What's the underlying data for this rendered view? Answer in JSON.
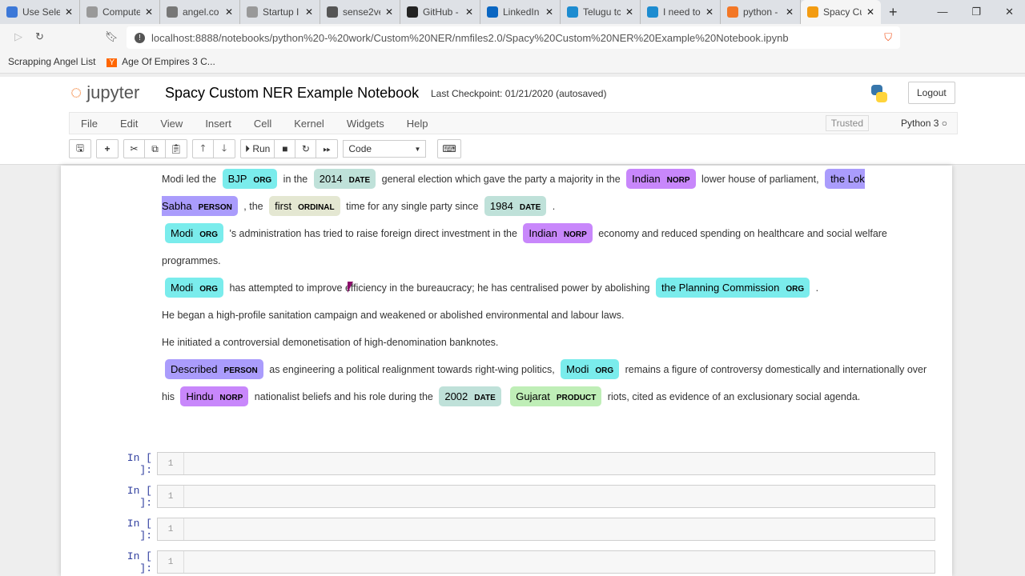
{
  "browser": {
    "tabs": [
      {
        "title": "Use Sele",
        "color": "#3c78d8"
      },
      {
        "title": "Compute",
        "color": "#999"
      },
      {
        "title": "angel.co",
        "color": "#777"
      },
      {
        "title": "Startup I",
        "color": "#999"
      },
      {
        "title": "sense2ve",
        "color": "#555"
      },
      {
        "title": "GitHub -",
        "color": "#222"
      },
      {
        "title": "LinkedIn",
        "color": "#0a66c2"
      },
      {
        "title": "Telugu tc",
        "color": "#1d8cd0"
      },
      {
        "title": "I need to",
        "color": "#1d8cd0"
      },
      {
        "title": "python -",
        "color": "#f37726"
      },
      {
        "title": "Spacy Cu",
        "color": "#f39c12"
      }
    ],
    "url": "localhost:8888/notebooks/python%20-%20work/Custom%20NER/nmfiles2.0/Spacy%20Custom%20NER%20Example%20Notebook.ipynb",
    "bookmarks": [
      "Scrapping Angel List",
      "Age Of Empires 3 C..."
    ]
  },
  "jupyter": {
    "logo_text": "jupyter",
    "notebook_title": "Spacy Custom NER Example Notebook",
    "checkpoint": "Last Checkpoint: 01/21/2020  (autosaved)",
    "logout": "Logout",
    "menu": [
      "File",
      "Edit",
      "View",
      "Insert",
      "Cell",
      "Kernel",
      "Widgets",
      "Help"
    ],
    "trusted": "Trusted",
    "kernel": "Python 3",
    "run_label": "Run",
    "cell_type": "Code"
  },
  "entity_colors": {
    "ORG": "#7aecec",
    "DATE": "#bfe1d9",
    "NORP": "#c887fb",
    "PERSON": "#aa9cfc",
    "ORDINAL": "#e4e7d2",
    "PRODUCT": "#bfeeb7"
  },
  "paragraphs": [
    [
      {
        "t": "Modi led the "
      },
      {
        "e": "BJP",
        "l": "ORG"
      },
      {
        "t": " in the "
      },
      {
        "e": "2014",
        "l": "DATE"
      },
      {
        "t": " general election which gave the party a majority in the "
      },
      {
        "e": "Indian",
        "l": "NORP"
      },
      {
        "t": " lower house of parliament, "
      },
      {
        "e": "the Lok Sabha",
        "l": "PERSON"
      },
      {
        "t": " , the "
      },
      {
        "e": "first",
        "l": "ORDINAL"
      },
      {
        "t": " time for any single party since "
      },
      {
        "e": "1984",
        "l": "DATE"
      },
      {
        "t": " ."
      }
    ],
    [
      {
        "e": "Modi",
        "l": "ORG"
      },
      {
        "t": " 's administration has tried to raise foreign direct investment in the "
      },
      {
        "e": "Indian",
        "l": "NORP"
      },
      {
        "t": " economy and reduced spending on healthcare and social welfare programmes."
      }
    ],
    [
      {
        "e": "Modi",
        "l": "ORG"
      },
      {
        "t": " has attempted to improve efficiency in the bureaucracy; he has centralised power by abolishing "
      },
      {
        "e": "the Planning Commission",
        "l": "ORG"
      },
      {
        "t": " ."
      }
    ],
    [
      {
        "t": "He began a high-profile sanitation campaign and weakened or abolished environmental and labour laws."
      }
    ],
    [
      {
        "t": "He initiated a controversial demonetisation of high-denomination banknotes."
      }
    ],
    [
      {
        "e": "Described",
        "l": "PERSON"
      },
      {
        "t": " as engineering a political realignment towards right-wing politics, "
      },
      {
        "e": "Modi",
        "l": "ORG"
      },
      {
        "t": " remains a figure of controversy domestically and internationally over his "
      },
      {
        "e": "Hindu",
        "l": "NORP"
      },
      {
        "t": " nationalist beliefs and his role during the "
      },
      {
        "e": "2002",
        "l": "DATE"
      },
      {
        "t": " "
      },
      {
        "e": "Gujarat",
        "l": "PRODUCT"
      },
      {
        "t": " riots, cited as evidence of an exclusionary social agenda."
      }
    ]
  ],
  "cells": [
    {
      "prompt": "In [ ]:",
      "line": "1"
    },
    {
      "prompt": "In [ ]:",
      "line": "1"
    },
    {
      "prompt": "In [ ]:",
      "line": "1"
    },
    {
      "prompt": "In [ ]:",
      "line": "1"
    }
  ]
}
